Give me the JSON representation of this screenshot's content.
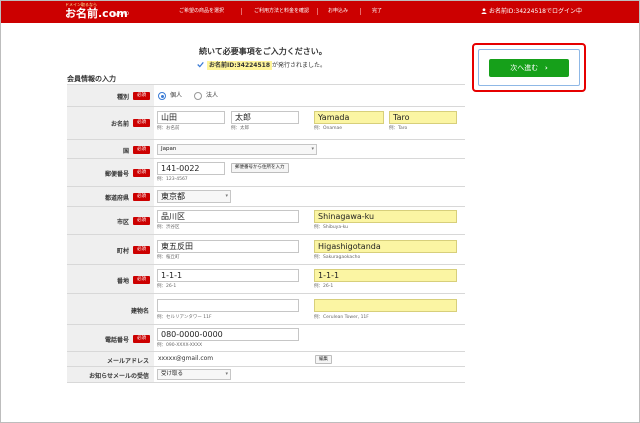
{
  "header": {
    "logo_small": "ドメイン取るなら",
    "logo_main": "お名前.com",
    "logo_sub": "by GMO",
    "nav": [
      "ご希望の商品を選択",
      "ご利用方法と料金を確認",
      "お申込み",
      "完了"
    ],
    "login_text": "お名前ID:34224518でログイン中"
  },
  "notice": {
    "title": "続いて必要事項をご入力ください。",
    "id_label": "お名前ID:34224518",
    "id_suffix": "が発行されました。"
  },
  "next_button": {
    "label": "次へ進む",
    "arrow": "›"
  },
  "section_title": "会員情報の入力",
  "required_badge": "必須",
  "form": {
    "type": {
      "label": "種別",
      "option1": "個人",
      "option2": "法人"
    },
    "name": {
      "label": "お名前",
      "last": "山田",
      "first": "太郎",
      "hint_last": "例：お名前",
      "hint_first": "例：太郎",
      "last_en": "Yamada",
      "first_en": "Taro",
      "hint_last_en": "例：Onamae",
      "hint_first_en": "例：Taro"
    },
    "country": {
      "label": "国",
      "value": "Japan"
    },
    "postal": {
      "label": "郵便番号",
      "value": "141-0022",
      "hint": "例：123-4567",
      "button": "郵便番号から住所を入力"
    },
    "prefecture": {
      "label": "都道府県",
      "value": "東京都"
    },
    "city": {
      "label": "市区",
      "value": "品川区",
      "hint": "例：渋谷区",
      "value_en": "Shinagawa-ku",
      "hint_en": "例：Shibuya-ku"
    },
    "town": {
      "label": "町村",
      "value": "東五反田",
      "hint": "例：桜丘町",
      "value_en": "Higashigotanda",
      "hint_en": "例：Sakuragaokacho"
    },
    "block": {
      "label": "番地",
      "value": "1-1-1",
      "hint": "例：26-1",
      "value_en": "1-1-1",
      "hint_en": "例：26-1"
    },
    "building": {
      "label": "建物名",
      "hint": "例：セルリアンタワー 11F",
      "hint_en": "例：Cerulean Tower, 11F"
    },
    "phone": {
      "label": "電話番号",
      "value": "080-0000-0000",
      "hint": "例：090-XXXX-XXXX"
    },
    "email": {
      "label": "メールアドレス",
      "value": "xxxxx@gmail.com",
      "button": "編集"
    },
    "newsletter": {
      "label": "お知らせメールの受信",
      "value": "受け取る"
    }
  },
  "colors": {
    "header": "#cc0000",
    "next_button": "#16a01a",
    "highlight": "#fbf5a3",
    "required": "#cc0000"
  }
}
